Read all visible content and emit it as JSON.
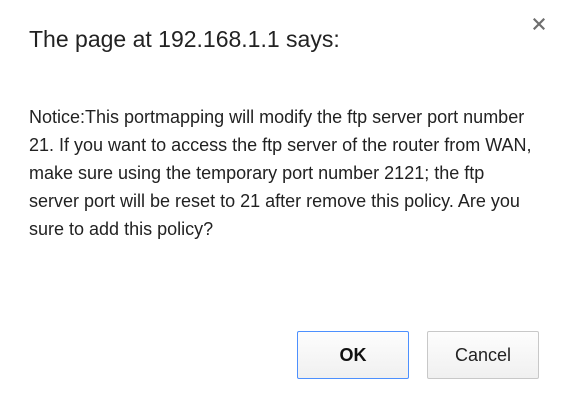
{
  "dialog": {
    "title": "The page at 192.168.1.1 says:",
    "message": "Notice:This portmapping will modify the ftp server port number 21. If you want to access the ftp server of the router from WAN, make sure using the temporary port number 2121; the ftp server port will be reset to 21 after remove this policy. Are you sure to add this policy?",
    "ok_label": "OK",
    "cancel_label": "Cancel",
    "close_icon": "close-icon"
  },
  "colors": {
    "focus_border": "#4d90fe",
    "text": "#222222"
  }
}
